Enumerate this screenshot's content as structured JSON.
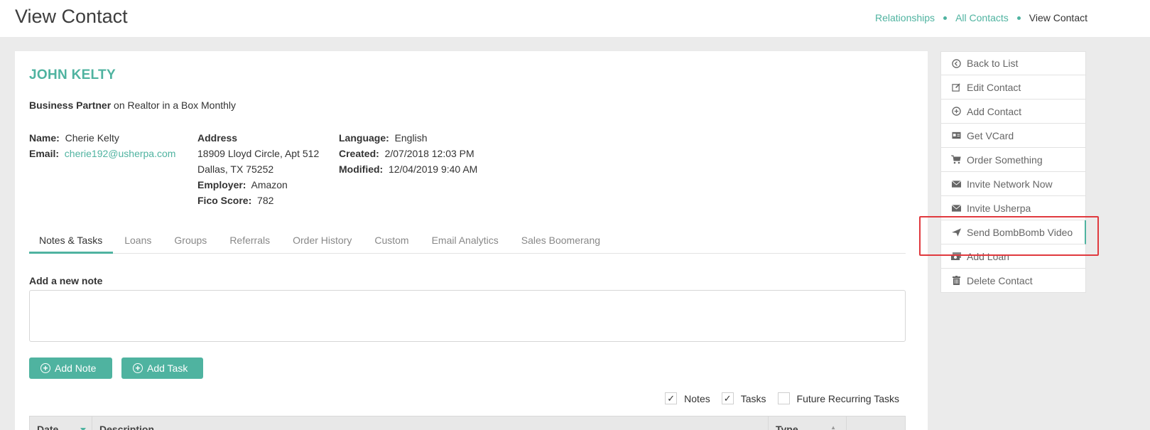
{
  "header": {
    "title": "View Contact",
    "breadcrumb": [
      "Relationships",
      "All Contacts",
      "View Contact"
    ]
  },
  "contact": {
    "name": "JOHN KELTY",
    "role_bold": "Business Partner",
    "role_rest": " on Realtor in a Box Monthly",
    "name_label": "Name:",
    "name_value": "Cherie Kelty",
    "email_label": "Email:",
    "email_value": "cherie192@usherpa.com",
    "address_label": "Address",
    "address_line1": "18909 Lloyd Circle, Apt 512",
    "address_line2": "Dallas, TX 75252",
    "employer_label": "Employer:",
    "employer_value": "Amazon",
    "fico_label": "Fico Score:",
    "fico_value": "782",
    "language_label": "Language:",
    "language_value": "English",
    "created_label": "Created:",
    "created_value": "2/07/2018 12:03 PM",
    "modified_label": "Modified:",
    "modified_value": "12/04/2019 9:40 AM"
  },
  "tabs": [
    {
      "label": "Notes & Tasks",
      "active": true
    },
    {
      "label": "Loans"
    },
    {
      "label": "Groups"
    },
    {
      "label": "Referrals"
    },
    {
      "label": "Order History"
    },
    {
      "label": "Custom"
    },
    {
      "label": "Email Analytics"
    },
    {
      "label": "Sales Boomerang"
    }
  ],
  "notes": {
    "label": "Add a new note",
    "add_note": "Add Note",
    "add_task": "Add Task",
    "filters": [
      {
        "label": "Notes",
        "checked": true
      },
      {
        "label": "Tasks",
        "checked": true
      },
      {
        "label": "Future Recurring Tasks",
        "checked": false
      }
    ],
    "columns": [
      "Date",
      "Description",
      "Type",
      ""
    ]
  },
  "sidebar": {
    "items": [
      {
        "label": "Back to List",
        "icon": "circle-left-icon"
      },
      {
        "label": "Edit Contact",
        "icon": "edit-icon"
      },
      {
        "label": "Add Contact",
        "icon": "plus-circle-icon"
      },
      {
        "label": "Get VCard",
        "icon": "id-card-icon"
      },
      {
        "label": "Order Something",
        "icon": "cart-icon"
      },
      {
        "label": "Invite Network Now",
        "icon": "envelope-icon"
      },
      {
        "label": "Invite Usherpa",
        "icon": "envelope-icon"
      },
      {
        "label": "Send BombBomb Video",
        "icon": "paper-plane-icon"
      },
      {
        "label": "Add Loan",
        "icon": "money-icon"
      },
      {
        "label": "Delete Contact",
        "icon": "trash-icon"
      }
    ]
  },
  "colors": {
    "accent": "#4fb3a0",
    "highlight": "#e0393e"
  }
}
